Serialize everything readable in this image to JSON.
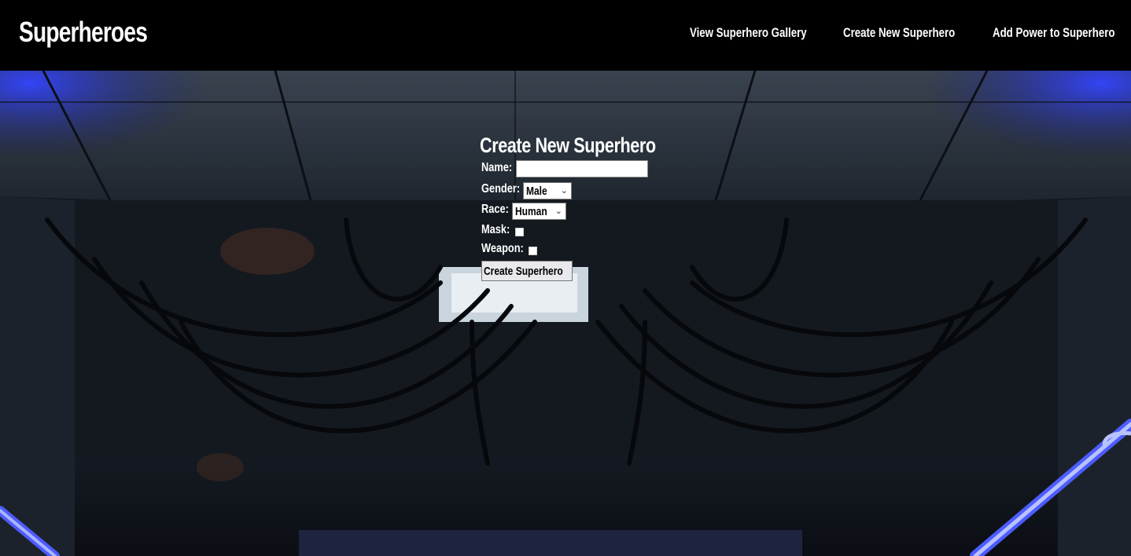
{
  "header": {
    "brand": "Superheroes",
    "nav": [
      {
        "label": "View Superhero Gallery"
      },
      {
        "label": "Create New Superhero"
      },
      {
        "label": "Add Power to Superhero"
      }
    ]
  },
  "form": {
    "title": "Create New Superhero",
    "name_label": "Name:",
    "name_value": "",
    "gender_label": "Gender:",
    "gender_selected": "Male",
    "race_label": "Race:",
    "race_selected": "Human",
    "mask_label": "Mask:",
    "mask_checked": false,
    "weapon_label": "Weapon:",
    "weapon_checked": false,
    "submit_label": "Create Superhero"
  },
  "colors": {
    "header_bg": "#000000",
    "neon_blue": "#2b3bff",
    "text": "#ffffff"
  }
}
